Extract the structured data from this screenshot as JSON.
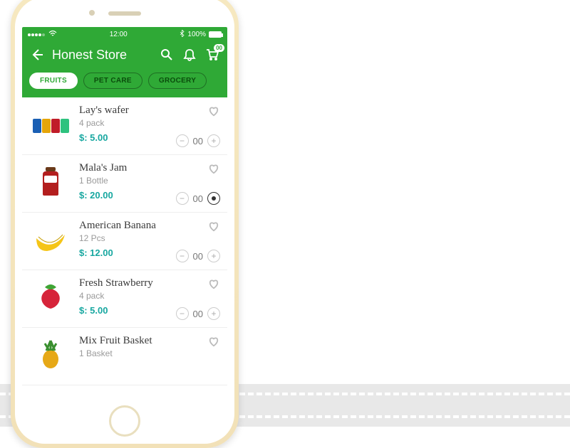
{
  "statusbar": {
    "time": "12:00",
    "battery": "100%"
  },
  "navbar": {
    "title": "Honest Store",
    "cart_badge": "00"
  },
  "tabs": [
    {
      "label": "FRUITS",
      "active": true
    },
    {
      "label": "PET CARE",
      "active": false
    },
    {
      "label": "GROCERY",
      "active": false
    }
  ],
  "currency_prefix": "$: ",
  "products": [
    {
      "name": "Lay's wafer",
      "sub": "4 pack",
      "price": "5.00",
      "qty": "00",
      "icon": "chips"
    },
    {
      "name": "Mala's Jam",
      "sub": "1 Bottle",
      "price": "20.00",
      "qty": "00",
      "icon": "jam",
      "plus_filled": true
    },
    {
      "name": "American Banana",
      "sub": "12 Pcs",
      "price": "12.00",
      "qty": "00",
      "icon": "banana"
    },
    {
      "name": "Fresh Strawberry",
      "sub": "4 pack",
      "price": "5.00",
      "qty": "00",
      "icon": "strawberry"
    },
    {
      "name": "Mix Fruit Basket",
      "sub": "1 Basket",
      "price": "",
      "qty": "",
      "icon": "pineapple"
    }
  ]
}
